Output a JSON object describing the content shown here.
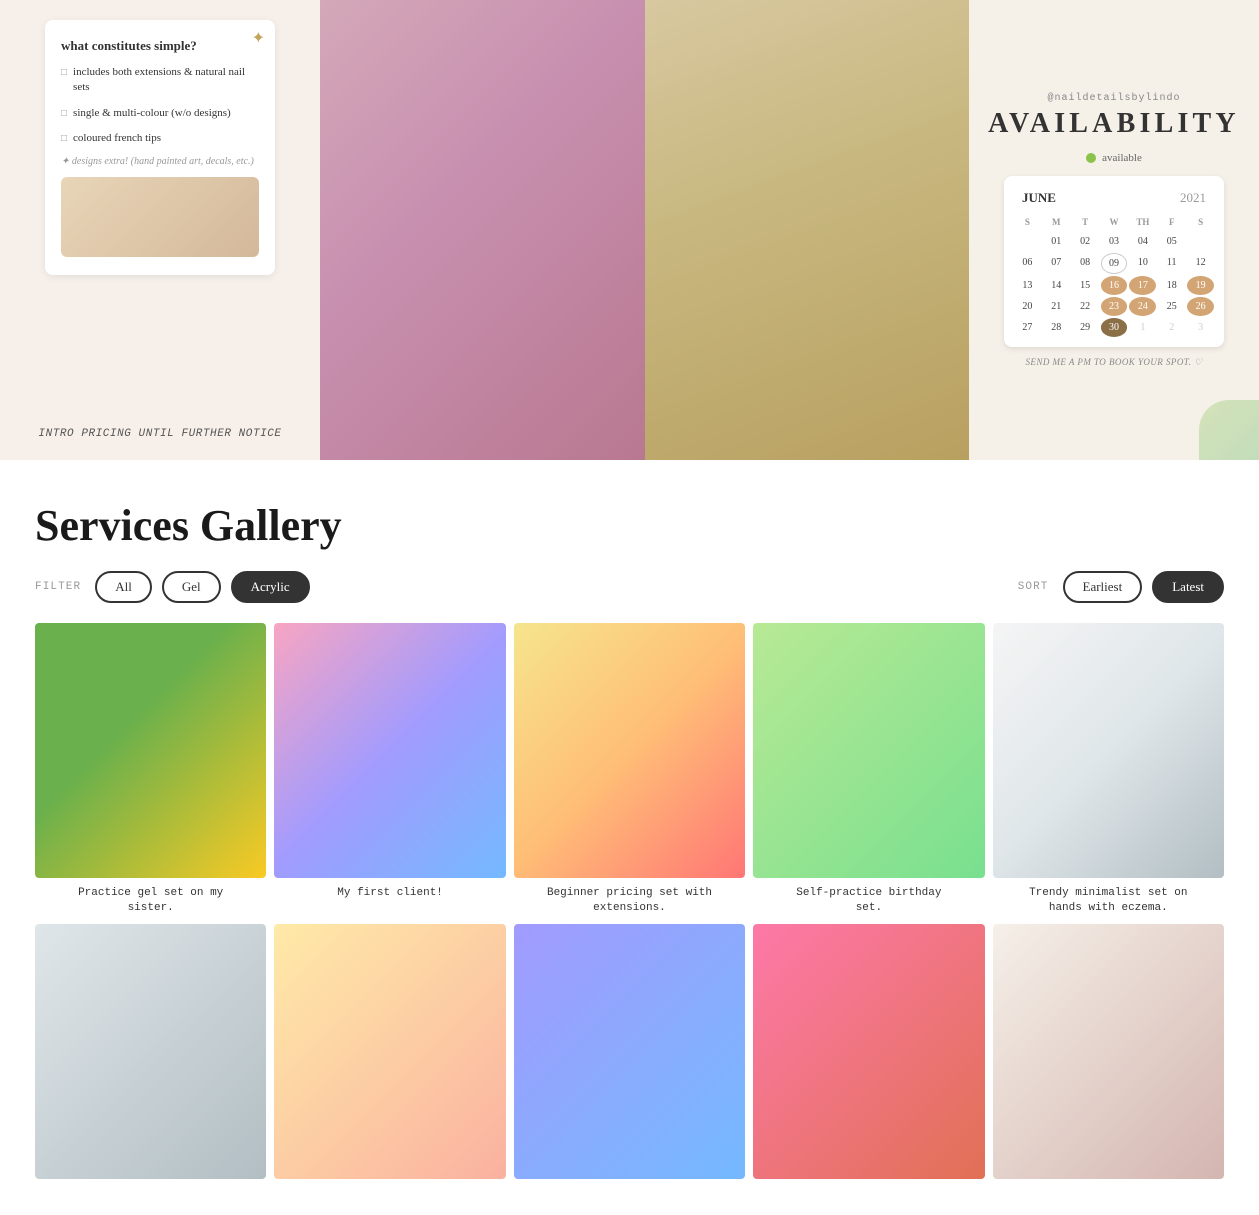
{
  "top": {
    "intro_card": {
      "title": "what constitutes simple?",
      "sparkle": "✦",
      "items": [
        "includes both extensions & natural nail sets",
        "single & multi-colour (w/o designs)",
        "coloured french tips"
      ],
      "note": "✦ designs extra! (hand painted art, decals, etc.)",
      "footer": "INTRO PRICING UNTIL FURTHER NOTICE"
    },
    "availability": {
      "handle": "@naildetailsbylindo",
      "title": "AVAILABILITY",
      "dot_label": "available",
      "calendar": {
        "month": "JUNE",
        "year": "2021",
        "headers": [
          "S",
          "M",
          "T",
          "W",
          "TH",
          "F",
          "S"
        ],
        "rows": [
          [
            "",
            "01",
            "02",
            "03",
            "04",
            "05"
          ],
          [
            "06",
            "07",
            "08",
            "09",
            "10",
            "11",
            "12"
          ],
          [
            "13",
            "14",
            "15",
            "16",
            "17",
            "18",
            "19"
          ],
          [
            "20",
            "21",
            "22",
            "23",
            "24",
            "25",
            "26"
          ],
          [
            "27",
            "28",
            "29",
            "30",
            "1",
            "2",
            "3"
          ]
        ],
        "highlighted": [
          "16",
          "17",
          "19",
          "23",
          "24",
          "26",
          "30"
        ],
        "muted_end": [
          "1",
          "2",
          "3"
        ]
      },
      "footer": "SEND ME A PM TO BOOK YOUR SPOT. ♡"
    }
  },
  "gallery": {
    "section_title": "Services Gallery",
    "filter_label": "FILTER",
    "sort_label": "SORT",
    "filters": [
      {
        "label": "All",
        "active": false
      },
      {
        "label": "Gel",
        "active": false
      },
      {
        "label": "Acrylic",
        "active": true
      }
    ],
    "sorts": [
      {
        "label": "Earliest",
        "active": false
      },
      {
        "label": "Latest",
        "active": true
      }
    ],
    "items_row1": [
      {
        "caption": "Practice gel set on my sister.",
        "swatch": "swatch-1"
      },
      {
        "caption": "My first client!",
        "swatch": "swatch-2"
      },
      {
        "caption": "Beginner pricing set with extensions.",
        "swatch": "swatch-3"
      },
      {
        "caption": "Self-practice birthday set.",
        "swatch": "swatch-4"
      },
      {
        "caption": "Trendy minimalist set on hands with eczema.",
        "swatch": "swatch-5"
      }
    ],
    "items_row2": [
      {
        "caption": "",
        "swatch": "swatch-6"
      },
      {
        "caption": "",
        "swatch": "swatch-7"
      },
      {
        "caption": "",
        "swatch": "swatch-8"
      },
      {
        "caption": "",
        "swatch": "swatch-9"
      },
      {
        "caption": "",
        "swatch": "swatch-10"
      }
    ]
  }
}
